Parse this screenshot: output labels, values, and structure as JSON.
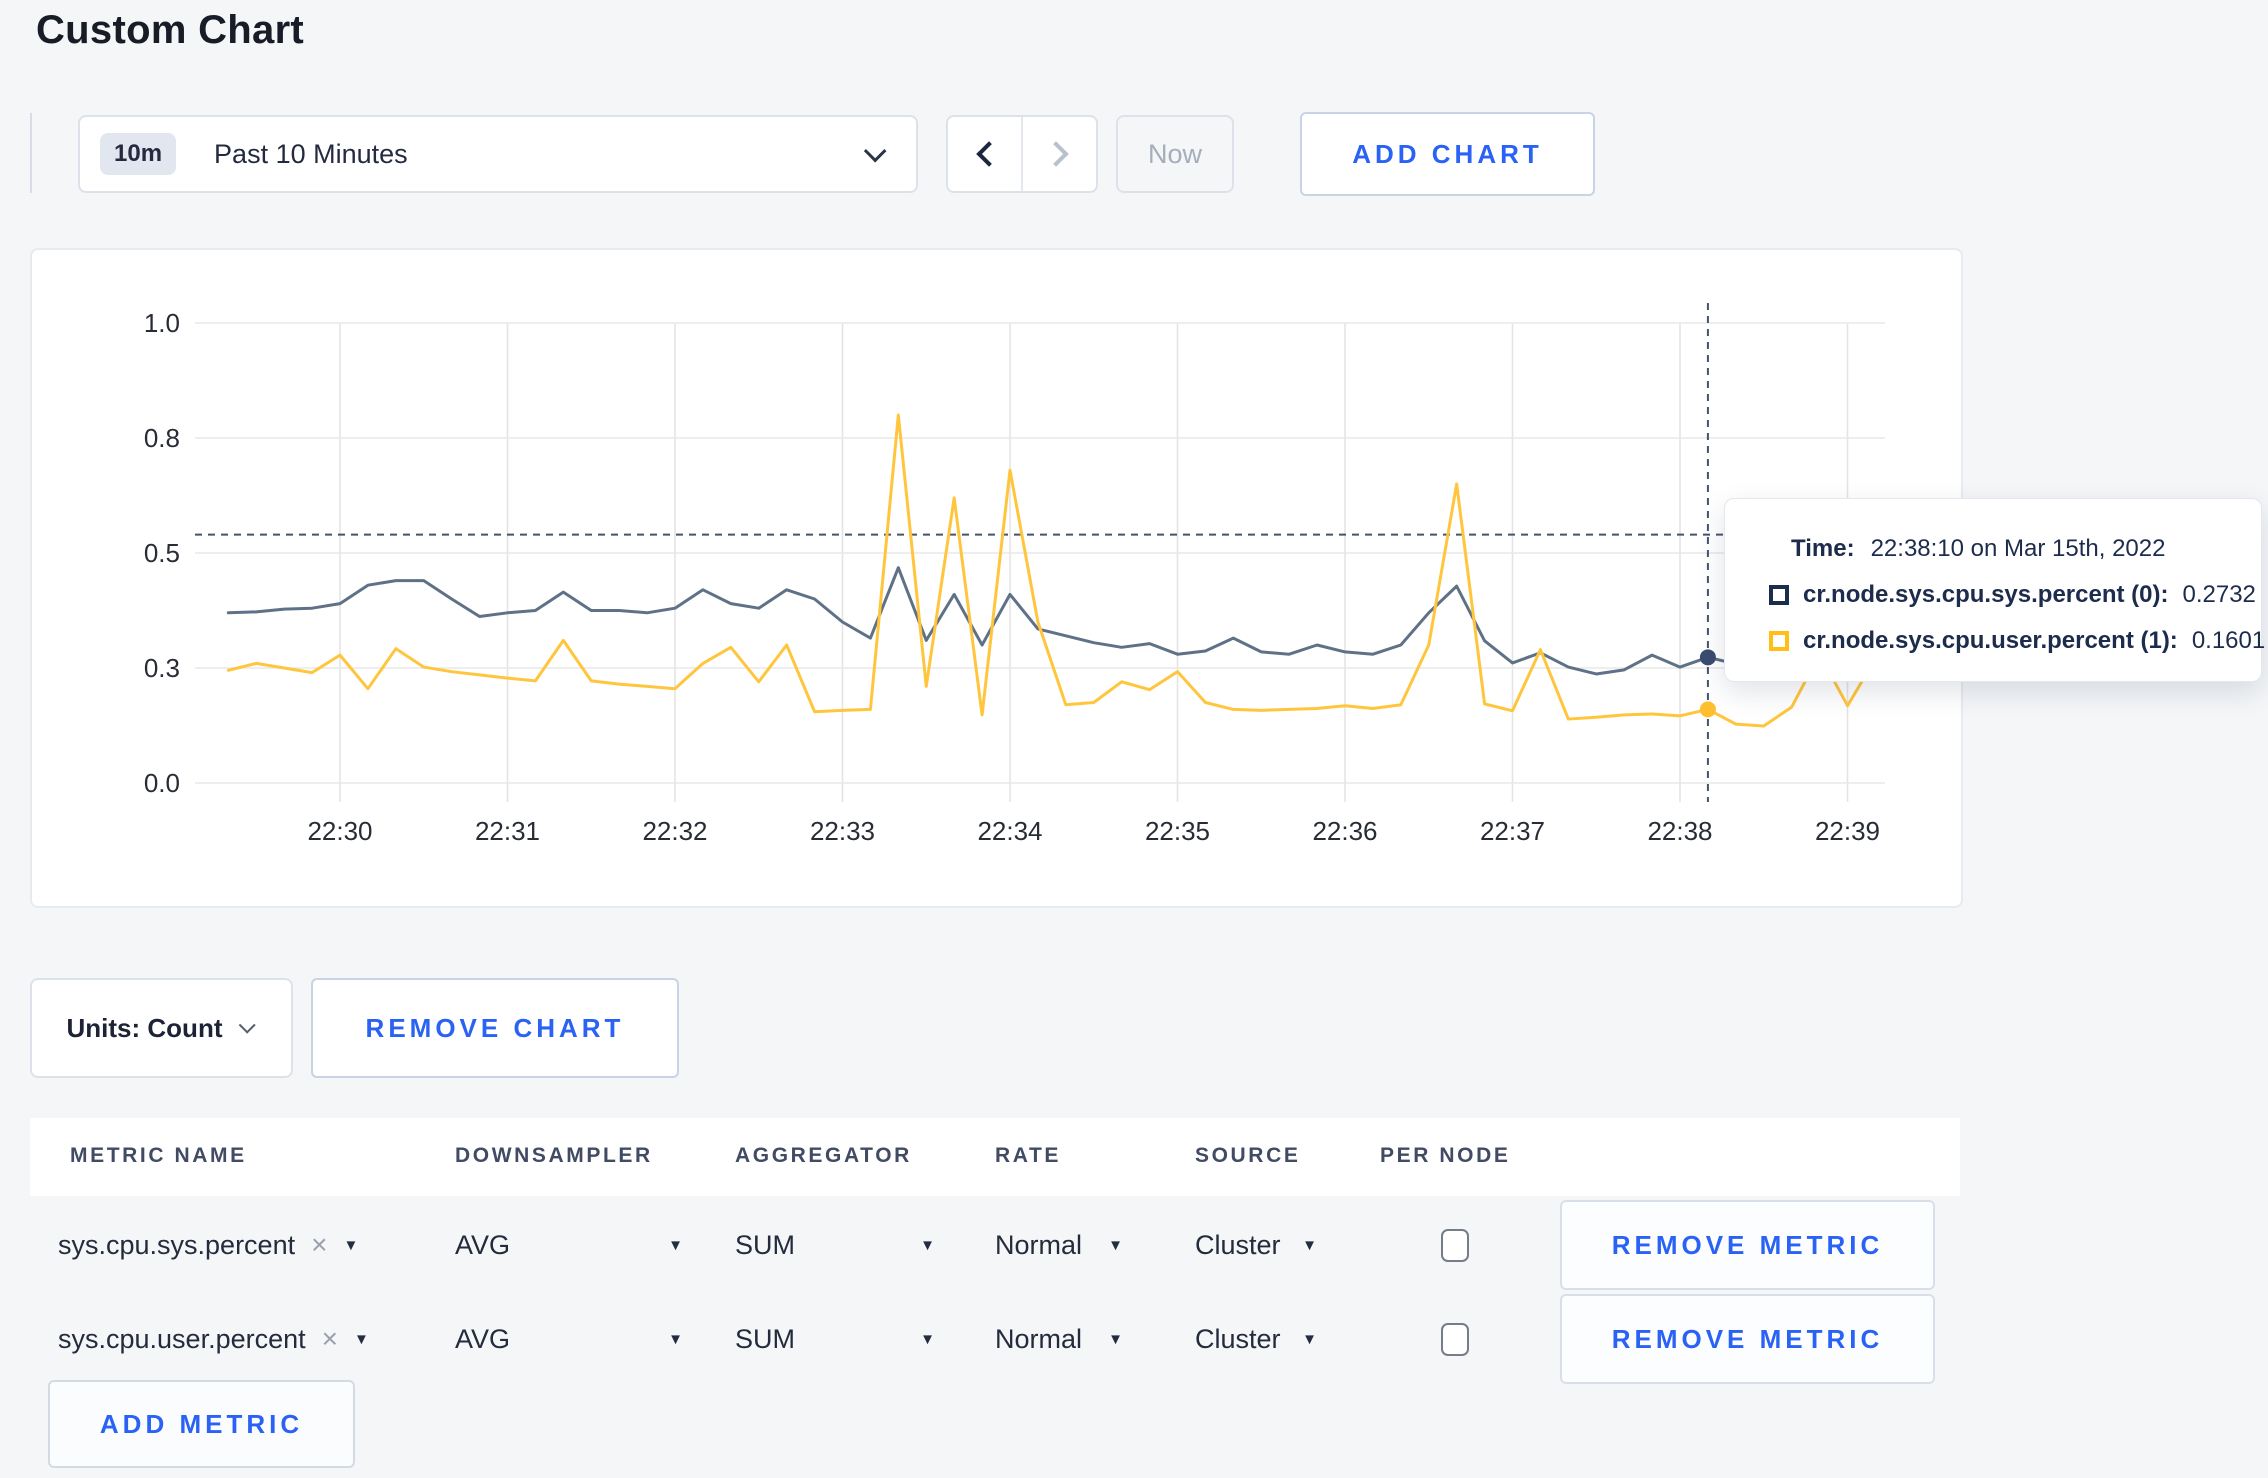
{
  "page": {
    "title": "Custom Chart",
    "background": "#f4f6f8",
    "accent_color": "#2a62f5"
  },
  "toolbar": {
    "range_badge": "10m",
    "range_label": "Past 10 Minutes",
    "now_label": "Now",
    "add_chart_label": "ADD CHART"
  },
  "chart_data": {
    "type": "line",
    "title": "",
    "xlabel": "",
    "ylabel": "",
    "ylim": [
      0,
      1
    ],
    "grid": true,
    "x_tick_labels": [
      "22:30",
      "22:31",
      "22:32",
      "22:33",
      "22:34",
      "22:35",
      "22:36",
      "22:37",
      "22:38",
      "22:39"
    ],
    "y_tick_labels": [
      "0.0",
      "0.3",
      "0.5",
      "0.8",
      "1.0"
    ],
    "y_tick_values": [
      0,
      0.25,
      0.5,
      0.75,
      1.0
    ],
    "start_time": "22:29:20",
    "interval_seconds": 10,
    "series": [
      {
        "name": "cr.node.sys.cpu.sys.percent (0)",
        "color": "#5f7186",
        "dot_color": "#3a4c70",
        "values": [
          0.37,
          0.372,
          0.378,
          0.38,
          0.39,
          0.43,
          0.44,
          0.44,
          0.4,
          0.362,
          0.37,
          0.375,
          0.415,
          0.375,
          0.375,
          0.37,
          0.38,
          0.42,
          0.39,
          0.38,
          0.42,
          0.4,
          0.35,
          0.315,
          0.468,
          0.31,
          0.41,
          0.3,
          0.41,
          0.335,
          0.32,
          0.305,
          0.295,
          0.303,
          0.28,
          0.287,
          0.315,
          0.285,
          0.28,
          0.3,
          0.285,
          0.28,
          0.3,
          0.37,
          0.428,
          0.309,
          0.261,
          0.283,
          0.252,
          0.237,
          0.246,
          0.278,
          0.252,
          0.2732,
          0.259,
          0.265,
          0.27,
          0.265,
          0.27,
          0.268
        ]
      },
      {
        "name": "cr.node.sys.cpu.user.percent (1)",
        "color": "#ffc63d",
        "dot_color": "#ffbe2d",
        "values": [
          0.245,
          0.26,
          0.25,
          0.24,
          0.278,
          0.205,
          0.292,
          0.252,
          0.242,
          0.235,
          0.228,
          0.222,
          0.31,
          0.222,
          0.215,
          0.21,
          0.205,
          0.26,
          0.295,
          0.22,
          0.3,
          0.155,
          0.158,
          0.16,
          0.8,
          0.21,
          0.62,
          0.148,
          0.68,
          0.35,
          0.17,
          0.175,
          0.22,
          0.203,
          0.242,
          0.175,
          0.16,
          0.158,
          0.16,
          0.162,
          0.168,
          0.162,
          0.17,
          0.3,
          0.65,
          0.172,
          0.157,
          0.29,
          0.139,
          0.143,
          0.148,
          0.15,
          0.146,
          0.1601,
          0.128,
          0.124,
          0.165,
          0.28,
          0.168,
          0.27
        ]
      }
    ],
    "hover": {
      "index": 53,
      "time": "22:38:10",
      "crosshair_y_value": 0.54,
      "values": [
        0.2732,
        0.1601
      ]
    },
    "legend_position": "tooltip-only"
  },
  "tooltip": {
    "time_label": "Time:",
    "time_value": "22:38:10 on Mar 15th, 2022",
    "rows": [
      {
        "label": "cr.node.sys.cpu.sys.percent (0):",
        "value": "0.2732",
        "swatch_color": "#1b2d4e"
      },
      {
        "label": "cr.node.sys.cpu.user.percent (1):",
        "value": "0.1601",
        "swatch_color": "#ffbf17"
      }
    ]
  },
  "chart_controls": {
    "units_label": "Units: Count",
    "remove_chart_label": "REMOVE CHART"
  },
  "metrics_table": {
    "headers": [
      "METRIC NAME",
      "DOWNSAMPLER",
      "AGGREGATOR",
      "RATE",
      "SOURCE",
      "PER NODE"
    ],
    "rows": [
      {
        "metric": "sys.cpu.sys.percent",
        "downsampler": "AVG",
        "aggregator": "SUM",
        "rate": "Normal",
        "source": "Cluster",
        "per_node_checked": false,
        "remove_label": "REMOVE METRIC"
      },
      {
        "metric": "sys.cpu.user.percent",
        "downsampler": "AVG",
        "aggregator": "SUM",
        "rate": "Normal",
        "source": "Cluster",
        "per_node_checked": false,
        "remove_label": "REMOVE METRIC"
      }
    ],
    "add_metric_label": "ADD METRIC",
    "close_glyph": "×",
    "caret_glyph": "▼"
  }
}
